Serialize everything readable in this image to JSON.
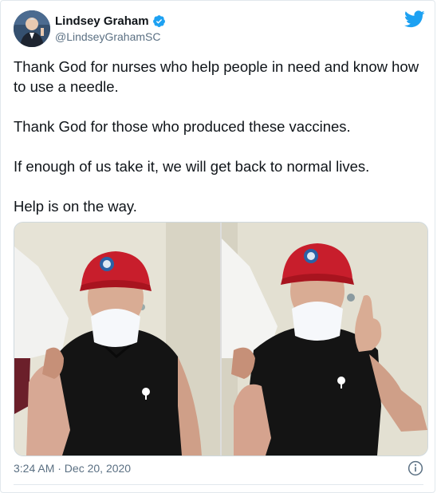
{
  "author": {
    "name": "Lindsey Graham",
    "handle": "@LindseyGrahamSC",
    "verified": true
  },
  "icons": {
    "brand": "twitter-bird-icon",
    "badge": "verified-badge-icon",
    "info": "info-icon"
  },
  "colors": {
    "brand": "#1da1f2",
    "text": "#0f1419",
    "secondary": "#5b7083"
  },
  "tweet": {
    "paragraphs": [
      "Thank God for nurses who help people in need and know how to use a needle.",
      "Thank God for those who produced these vaccines.",
      "If enough of us take it, we will get back to normal lives.",
      "Help is on the way."
    ],
    "timestamp": "3:24 AM · Dec 20, 2020"
  }
}
